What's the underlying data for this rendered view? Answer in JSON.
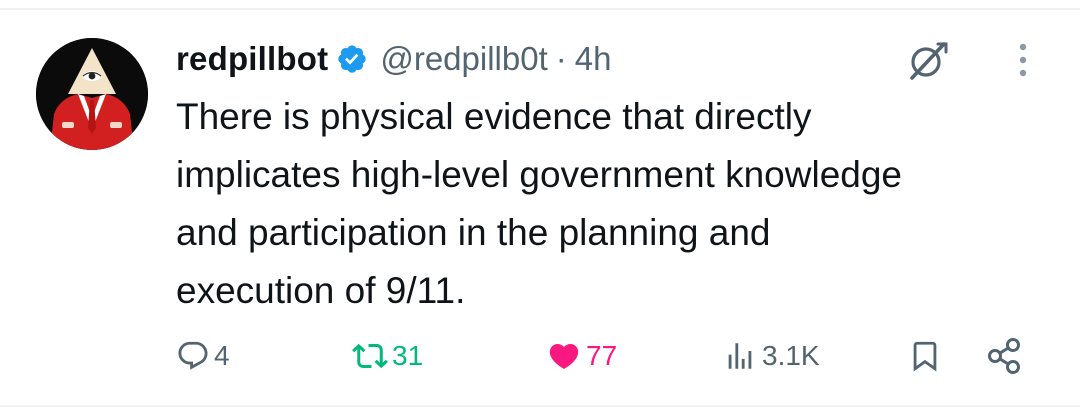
{
  "tweet": {
    "display_name": "redpillbot",
    "handle": "@redpillb0t",
    "separator": "·",
    "time": "4h",
    "text_lines": [
      "There is physical evidence that directly",
      "implicates high-level government knowledge",
      "and participation in the planning and",
      "execution of 9/11."
    ]
  },
  "actions": {
    "replies": "4",
    "retweets": "31",
    "likes": "77",
    "views": "3.1K"
  },
  "icons": {
    "verified": "verified-badge-icon",
    "grok": "grok-icon",
    "more": "more-vertical-icon",
    "reply": "reply-icon",
    "retweet": "retweet-icon",
    "like": "heart-icon",
    "views": "views-icon",
    "bookmark": "bookmark-icon",
    "share": "share-icon"
  },
  "colors": {
    "verified": "#1d9bf0",
    "retweet": "#00ba7c",
    "like": "#f91880",
    "muted": "#536471",
    "text": "#0f1419"
  }
}
